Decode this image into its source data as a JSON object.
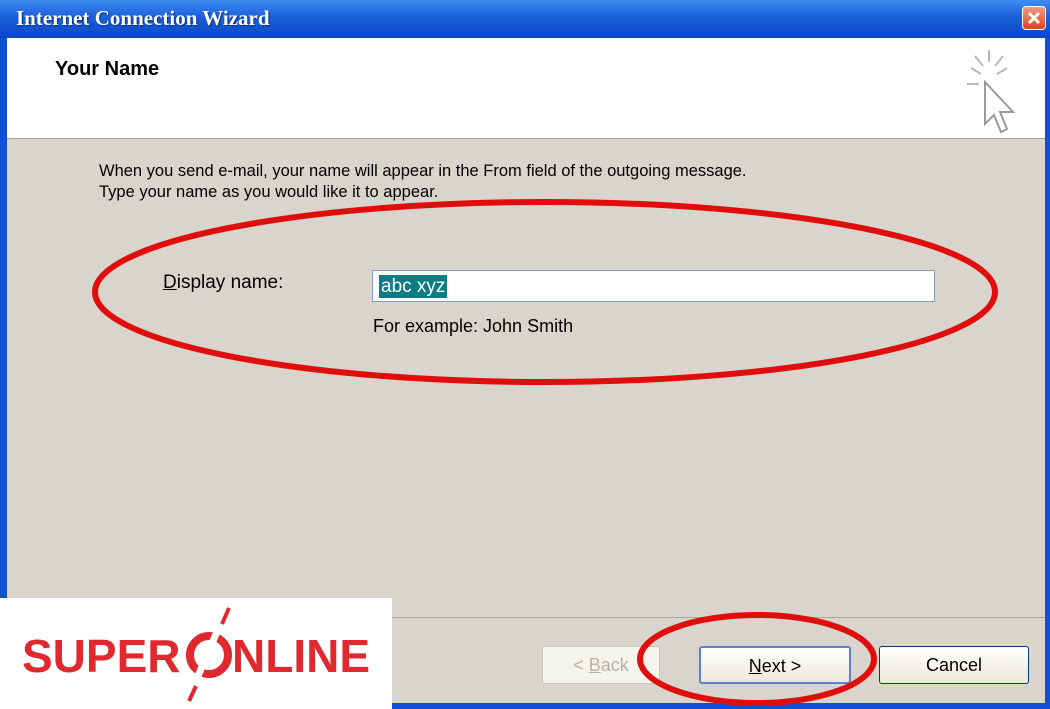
{
  "window": {
    "title": "Internet Connection Wizard",
    "close_icon": "close-icon"
  },
  "header": {
    "title": "Your Name",
    "icon": "wizard-cursor-icon"
  },
  "content": {
    "description_line1": "When you send e-mail, your name will appear in the From field of the outgoing message.",
    "description_line2": "Type your name as you would like it to appear.",
    "display_name_label_prefix": "D",
    "display_name_label_rest": "isplay name:",
    "display_name_value": "abc xyz",
    "example_text": "For example: John Smith"
  },
  "buttons": {
    "back_prefix": "< ",
    "back_mnemonic": "B",
    "back_rest": "ack",
    "next_mnemonic": "N",
    "next_rest": "ext >",
    "cancel_label": "Cancel"
  },
  "logo": {
    "text_left": "SUPER",
    "text_right": "NLINE",
    "brand_color": "#e0292e"
  },
  "colors": {
    "titlebar": "#1a5fd8",
    "annotation_red": "#e00d0d",
    "selection": "#0b7c84"
  }
}
